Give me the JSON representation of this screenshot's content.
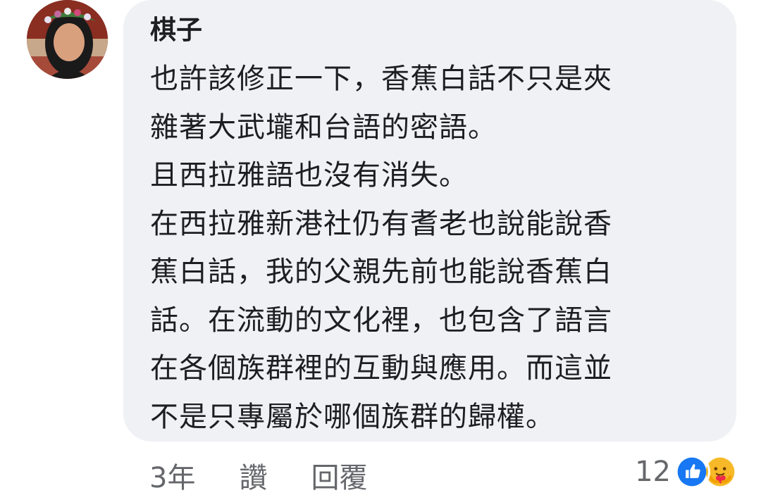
{
  "comment": {
    "author": "棋子",
    "lines": [
      "也許該修正一下，香蕉白話不只是夾",
      "雜著大武壠和台語的密語。",
      "且西拉雅語也沒有消失。",
      "在西拉雅新港社仍有耆老也說能說香",
      "蕉白話，我的父親先前也能說香蕉白",
      "話。在流動的文化裡，也包含了語言",
      "在各個族群裡的互動與應用。而這並",
      "不是只專屬於哪個族群的歸權。"
    ]
  },
  "actions": {
    "time": "3年",
    "like_label": "讚",
    "reply_label": "回覆"
  },
  "reactions": {
    "count": "12",
    "icons": [
      "like-icon",
      "care-icon"
    ],
    "colors": {
      "like": "#1877f2",
      "care": "#f7b928"
    }
  },
  "colors": {
    "bubble": "#eff1f4",
    "text": "#1c1e21",
    "secondary": "#65676b"
  }
}
